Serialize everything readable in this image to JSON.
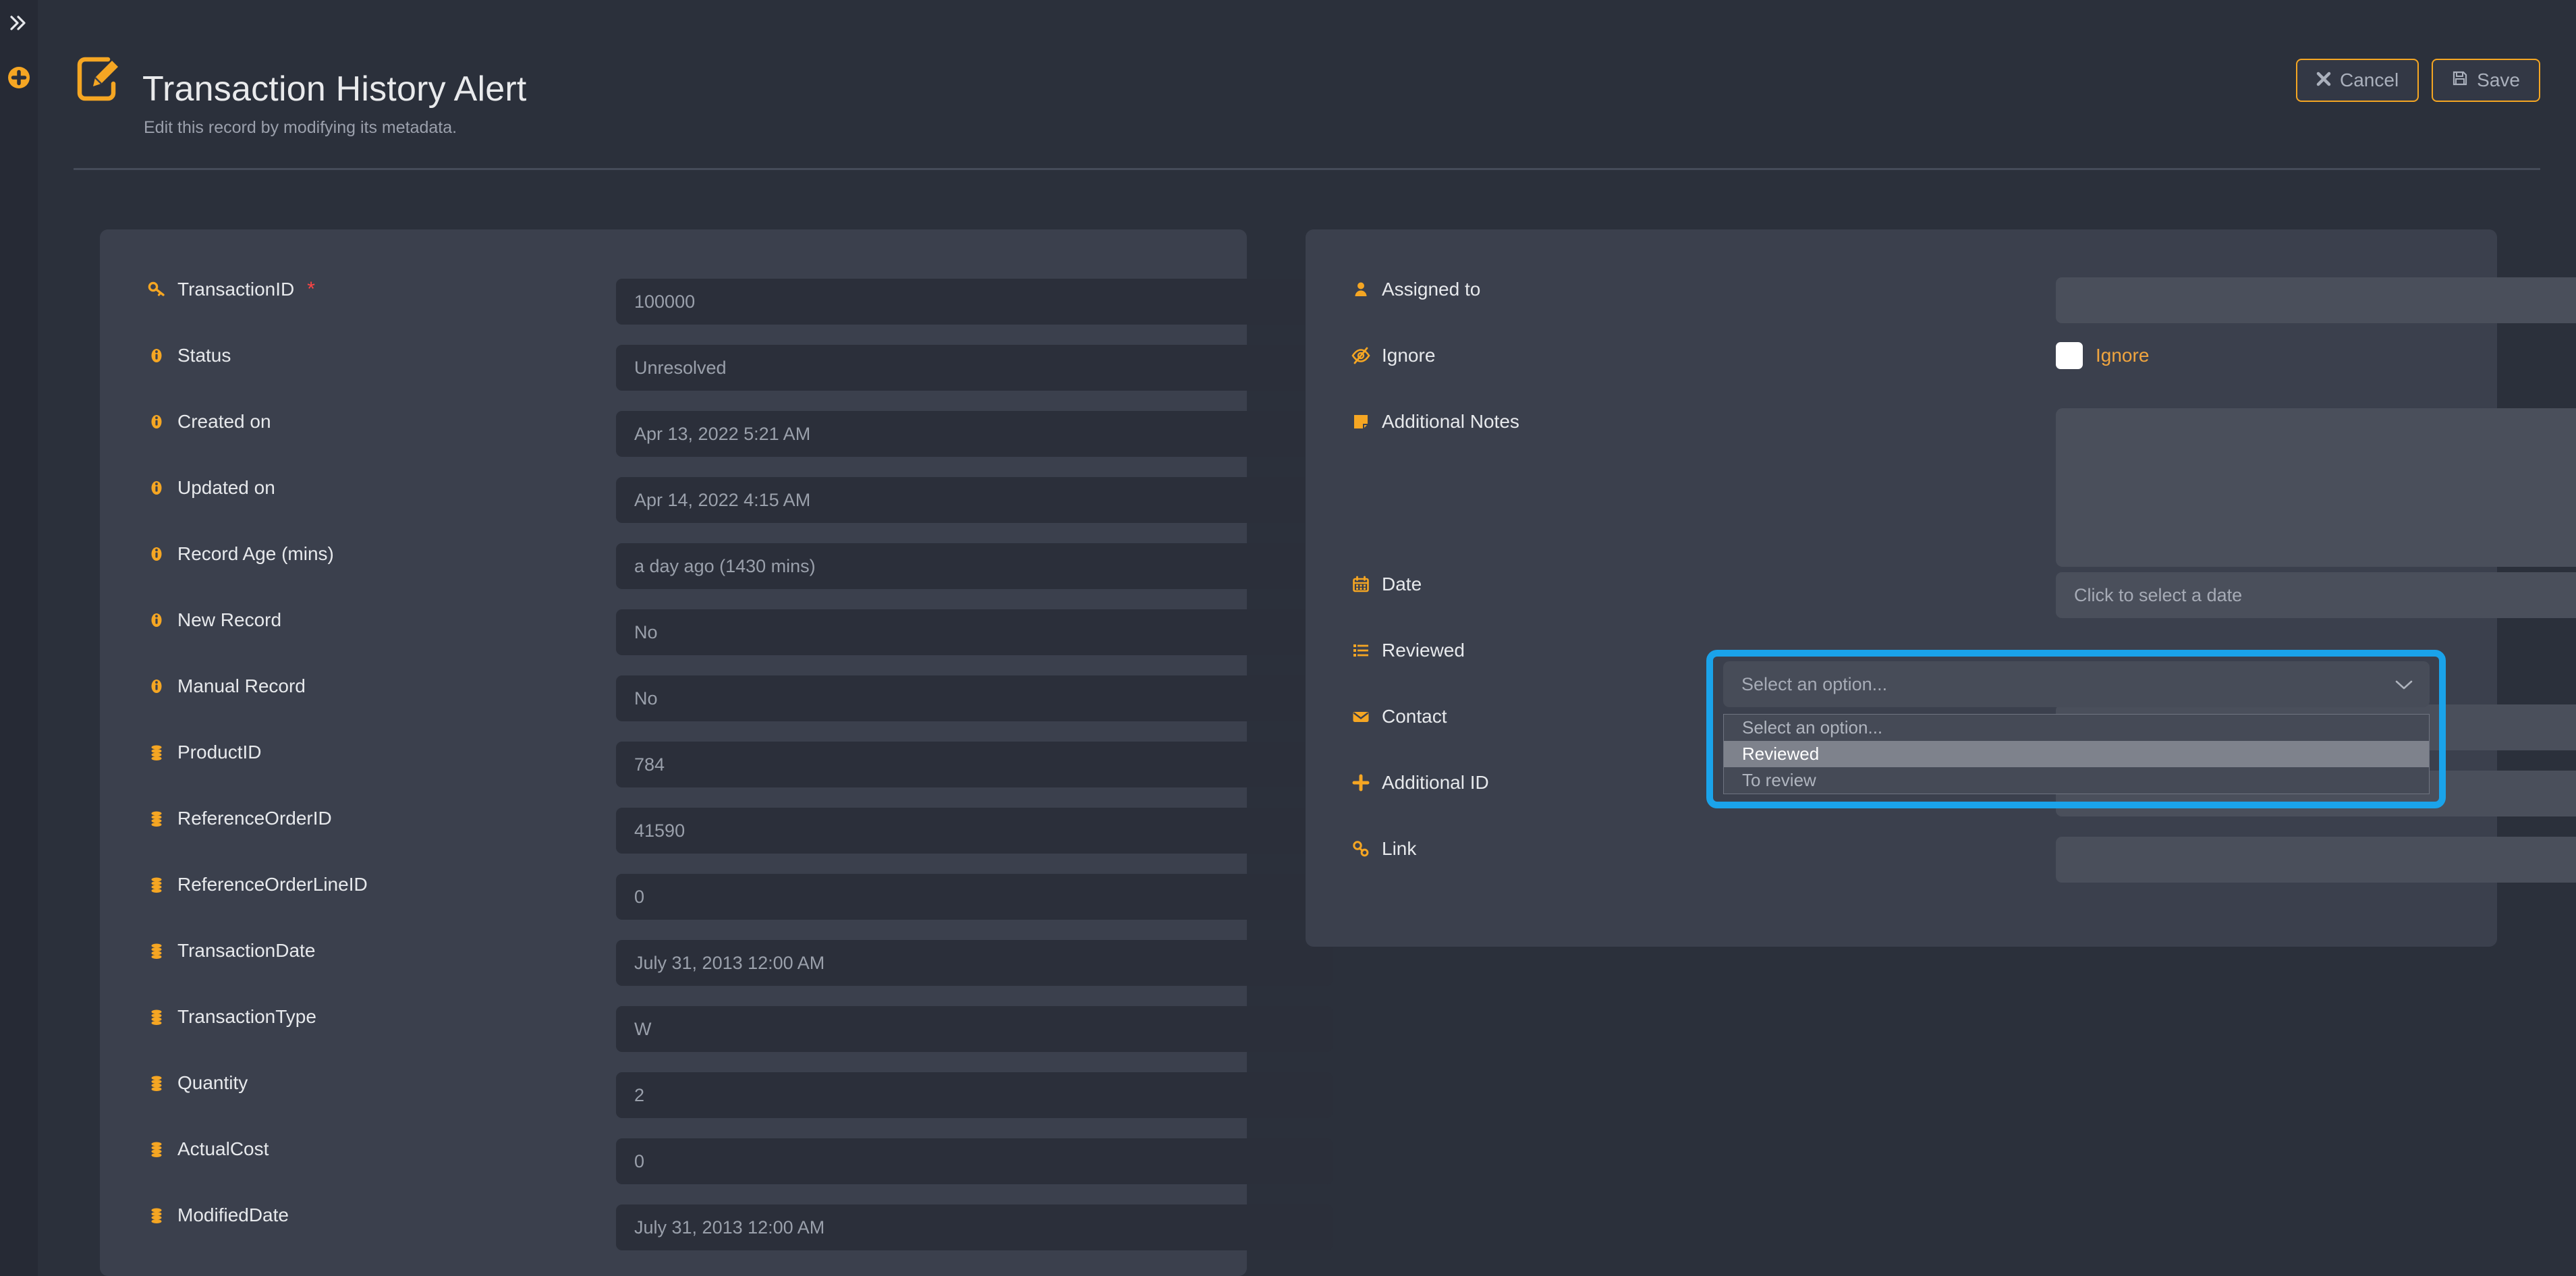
{
  "rail": {
    "expand_icon": "double-chevron-right-icon",
    "add_icon": "plus-circle-icon"
  },
  "header": {
    "icon": "edit-record-icon",
    "title": "Transaction History Alert",
    "subtitle": "Edit this record by modifying its metadata.",
    "cancel_label": "Cancel",
    "save_label": "Save",
    "cancel_icon": "close-x-icon",
    "save_icon": "floppy-disk-icon"
  },
  "colors": {
    "page_bg": "#2b303b",
    "panel_bg": "#3b404d",
    "accent": "#f5a623",
    "highlight": "#1aa3ea",
    "required": "#ff4444",
    "readonly_field": "#2b2f3a",
    "editable_field": "#4a4f5b"
  },
  "left_panel": {
    "fields": [
      {
        "icon": "key-icon",
        "label": "TransactionID",
        "required": true,
        "value": "100000",
        "editable": false
      },
      {
        "icon": "info-icon",
        "label": "Status",
        "required": false,
        "value": "Unresolved",
        "editable": false
      },
      {
        "icon": "info-icon",
        "label": "Created on",
        "required": false,
        "value": "Apr 13, 2022 5:21 AM",
        "editable": false
      },
      {
        "icon": "info-icon",
        "label": "Updated on",
        "required": false,
        "value": "Apr 14, 2022 4:15 AM",
        "editable": false
      },
      {
        "icon": "info-icon",
        "label": "Record Age (mins)",
        "required": false,
        "value": "a day ago (1430 mins)",
        "editable": false
      },
      {
        "icon": "info-icon",
        "label": "New Record",
        "required": false,
        "value": "No",
        "editable": false
      },
      {
        "icon": "info-icon",
        "label": "Manual Record",
        "required": false,
        "value": "No",
        "editable": false
      },
      {
        "icon": "database-icon",
        "label": "ProductID",
        "required": false,
        "value": "784",
        "editable": false
      },
      {
        "icon": "database-icon",
        "label": "ReferenceOrderID",
        "required": false,
        "value": "41590",
        "editable": false
      },
      {
        "icon": "database-icon",
        "label": "ReferenceOrderLineID",
        "required": false,
        "value": "0",
        "editable": false
      },
      {
        "icon": "database-icon",
        "label": "TransactionDate",
        "required": false,
        "value": "July 31, 2013 12:00 AM",
        "editable": false
      },
      {
        "icon": "database-icon",
        "label": "TransactionType",
        "required": false,
        "value": "W",
        "editable": false
      },
      {
        "icon": "database-icon",
        "label": "Quantity",
        "required": false,
        "value": "2",
        "editable": false
      },
      {
        "icon": "database-icon",
        "label": "ActualCost",
        "required": false,
        "value": "0",
        "editable": false
      },
      {
        "icon": "database-icon",
        "label": "ModifiedDate",
        "required": false,
        "value": "July 31, 2013 12:00 AM",
        "editable": false
      }
    ]
  },
  "right_panel": {
    "assigned_to": {
      "icon": "person-icon",
      "label": "Assigned to",
      "value": ""
    },
    "ignore": {
      "icon": "eye-slash-icon",
      "label": "Ignore",
      "checkbox_label": "Ignore",
      "checked": false
    },
    "additional_notes": {
      "icon": "sticky-note-icon",
      "label": "Additional Notes",
      "value": ""
    },
    "date": {
      "icon": "calendar-icon",
      "label": "Date",
      "placeholder": "Click to select a date",
      "value": ""
    },
    "reviewed": {
      "icon": "list-icon",
      "label": "Reviewed"
    },
    "contact": {
      "icon": "envelope-icon",
      "label": "Contact",
      "value": ""
    },
    "additional_id": {
      "icon": "plus-icon",
      "label": "Additional ID",
      "value": ""
    },
    "link": {
      "icon": "link-icon",
      "label": "Link",
      "value": ""
    }
  },
  "reviewed_select": {
    "trigger_text": "Select an option...",
    "chevron_icon": "chevron-down-icon",
    "open": true,
    "options": [
      {
        "label": "Select an option...",
        "selected": false
      },
      {
        "label": "Reviewed",
        "selected": true
      },
      {
        "label": "To review",
        "selected": false
      }
    ]
  }
}
